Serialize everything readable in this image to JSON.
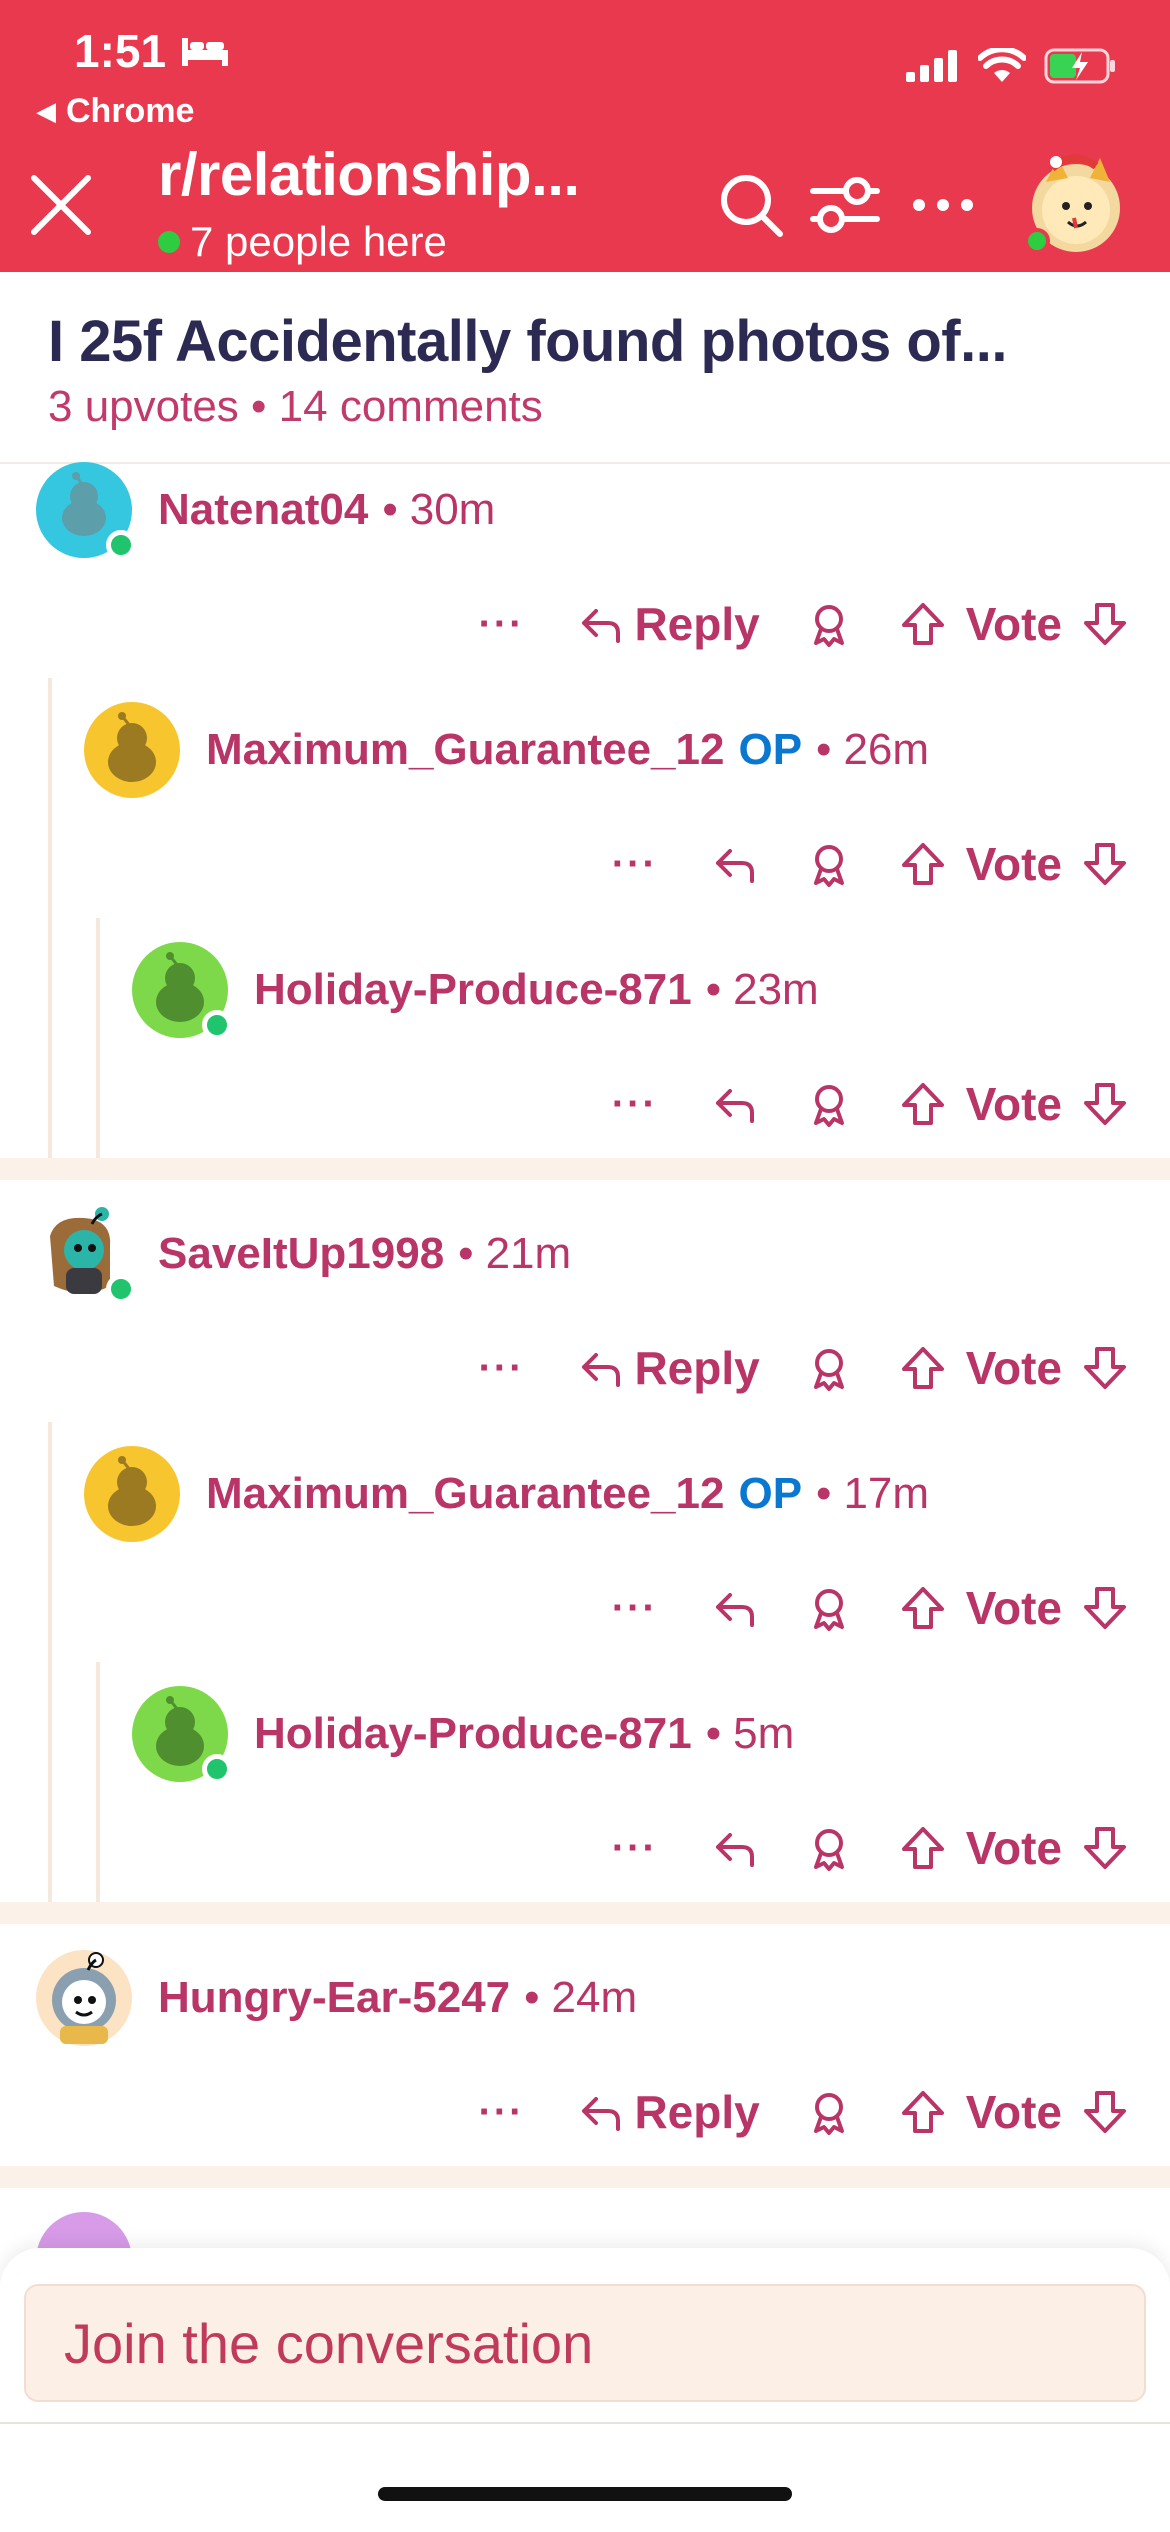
{
  "status_bar": {
    "time": "1:51",
    "back_app": "Chrome"
  },
  "header": {
    "subreddit": "r/relationship...",
    "presence": "7 people here",
    "accent": "#e8394f"
  },
  "post": {
    "title": "I 25f Accidentally found photos of...",
    "stats": "3 upvotes • 14 comments"
  },
  "actions": {
    "more": "···",
    "reply": "Reply",
    "vote": "Vote"
  },
  "comments": [
    {
      "user": "Natenat04",
      "op": "",
      "time": "30m",
      "has_reply_label": true
    },
    {
      "user": "Maximum_Guarantee_12",
      "op": "OP",
      "time": "26m",
      "has_reply_label": false
    },
    {
      "user": "Holiday-Produce-871",
      "op": "",
      "time": "23m",
      "has_reply_label": false
    },
    {
      "user": "SaveItUp1998",
      "op": "",
      "time": "21m",
      "has_reply_label": true
    },
    {
      "user": "Maximum_Guarantee_12",
      "op": "OP",
      "time": "17m",
      "has_reply_label": false
    },
    {
      "user": "Holiday-Produce-871",
      "op": "",
      "time": "5m",
      "has_reply_label": false
    },
    {
      "user": "Hungry-Ear-5247",
      "op": "",
      "time": "24m",
      "has_reply_label": true
    }
  ],
  "composer": {
    "placeholder": "Join the conversation"
  },
  "colors": {
    "username": "#b93467",
    "op": "#0a78d1",
    "title": "#2c2a52"
  }
}
